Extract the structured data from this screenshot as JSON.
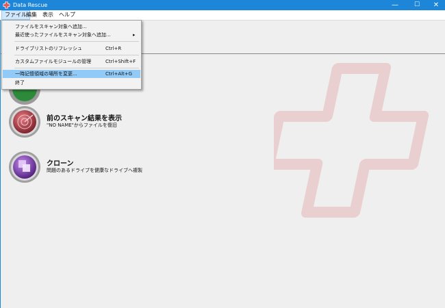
{
  "window": {
    "title": "Data Rescue",
    "min": "—",
    "max": "☐",
    "close": "✕"
  },
  "menubar": [
    "ファイル",
    "編集",
    "表示",
    "ヘルプ"
  ],
  "file_menu": {
    "items": [
      {
        "label": "ファイルをスキャン対象へ追加...",
        "shortcut": ""
      },
      {
        "label": "最近使ったファイルをスキャン対象へ追加...",
        "shortcut": "",
        "submenu_arrow": "▸"
      },
      {
        "label": "ドライブリストのリフレッシュ",
        "shortcut": "Ctrl+R"
      },
      {
        "label": "カスタムファイルモジュールの管理",
        "shortcut": "Ctrl+Shift+F"
      },
      {
        "label": "一時記憶領域の場所を変更...",
        "shortcut": "Ctrl+Alt+G",
        "highlighted": true
      },
      {
        "label": "終了",
        "shortcut": ""
      }
    ]
  },
  "actions": [
    {
      "label": "前のスキャン結果を表示",
      "desc": "\"NO NAME\"からファイルを復旧",
      "color": "#b83a45"
    },
    {
      "label": "クローン",
      "desc": "問題のあるドライブを健康なドライブへ複製",
      "color": "#8a3fc0"
    }
  ],
  "colors": {
    "titlebar": "#1e86d8",
    "highlight": "#91c9f7",
    "watermark": "#e6b3b3"
  }
}
